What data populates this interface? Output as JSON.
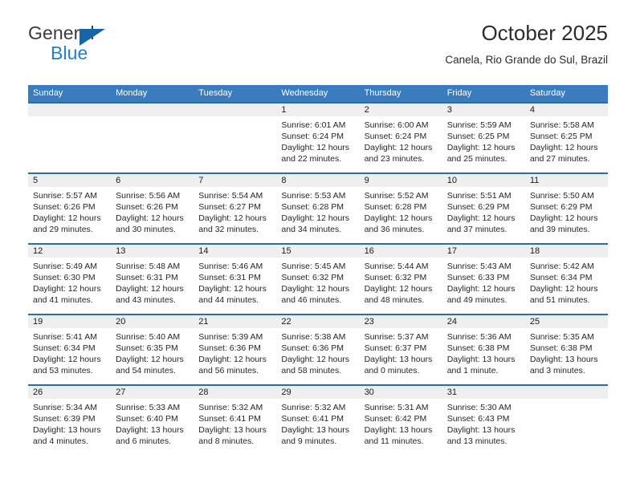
{
  "brand": {
    "name_part1": "General",
    "name_part2": "Blue",
    "triangle_color": "#1565a8",
    "blue_color": "#1f7fd0"
  },
  "header": {
    "title": "October 2025",
    "subtitle": "Canela, Rio Grande do Sul, Brazil"
  },
  "theme": {
    "header_row_bg": "#3b7cbf",
    "week_separator": "#2e6da4",
    "date_strip_bg": "#efefef"
  },
  "weekdays": [
    "Sunday",
    "Monday",
    "Tuesday",
    "Wednesday",
    "Thursday",
    "Friday",
    "Saturday"
  ],
  "weeks": [
    [
      {
        "day": "",
        "empty": true,
        "sunrise": "",
        "sunset": "",
        "daylight_line1": "",
        "daylight_line2": ""
      },
      {
        "day": "",
        "empty": true,
        "sunrise": "",
        "sunset": "",
        "daylight_line1": "",
        "daylight_line2": ""
      },
      {
        "day": "",
        "empty": true,
        "sunrise": "",
        "sunset": "",
        "daylight_line1": "",
        "daylight_line2": ""
      },
      {
        "day": "1",
        "sunrise": "Sunrise: 6:01 AM",
        "sunset": "Sunset: 6:24 PM",
        "daylight_line1": "Daylight: 12 hours",
        "daylight_line2": "and 22 minutes."
      },
      {
        "day": "2",
        "sunrise": "Sunrise: 6:00 AM",
        "sunset": "Sunset: 6:24 PM",
        "daylight_line1": "Daylight: 12 hours",
        "daylight_line2": "and 23 minutes."
      },
      {
        "day": "3",
        "sunrise": "Sunrise: 5:59 AM",
        "sunset": "Sunset: 6:25 PM",
        "daylight_line1": "Daylight: 12 hours",
        "daylight_line2": "and 25 minutes."
      },
      {
        "day": "4",
        "sunrise": "Sunrise: 5:58 AM",
        "sunset": "Sunset: 6:25 PM",
        "daylight_line1": "Daylight: 12 hours",
        "daylight_line2": "and 27 minutes."
      }
    ],
    [
      {
        "day": "5",
        "sunrise": "Sunrise: 5:57 AM",
        "sunset": "Sunset: 6:26 PM",
        "daylight_line1": "Daylight: 12 hours",
        "daylight_line2": "and 29 minutes."
      },
      {
        "day": "6",
        "sunrise": "Sunrise: 5:56 AM",
        "sunset": "Sunset: 6:26 PM",
        "daylight_line1": "Daylight: 12 hours",
        "daylight_line2": "and 30 minutes."
      },
      {
        "day": "7",
        "sunrise": "Sunrise: 5:54 AM",
        "sunset": "Sunset: 6:27 PM",
        "daylight_line1": "Daylight: 12 hours",
        "daylight_line2": "and 32 minutes."
      },
      {
        "day": "8",
        "sunrise": "Sunrise: 5:53 AM",
        "sunset": "Sunset: 6:28 PM",
        "daylight_line1": "Daylight: 12 hours",
        "daylight_line2": "and 34 minutes."
      },
      {
        "day": "9",
        "sunrise": "Sunrise: 5:52 AM",
        "sunset": "Sunset: 6:28 PM",
        "daylight_line1": "Daylight: 12 hours",
        "daylight_line2": "and 36 minutes."
      },
      {
        "day": "10",
        "sunrise": "Sunrise: 5:51 AM",
        "sunset": "Sunset: 6:29 PM",
        "daylight_line1": "Daylight: 12 hours",
        "daylight_line2": "and 37 minutes."
      },
      {
        "day": "11",
        "sunrise": "Sunrise: 5:50 AM",
        "sunset": "Sunset: 6:29 PM",
        "daylight_line1": "Daylight: 12 hours",
        "daylight_line2": "and 39 minutes."
      }
    ],
    [
      {
        "day": "12",
        "sunrise": "Sunrise: 5:49 AM",
        "sunset": "Sunset: 6:30 PM",
        "daylight_line1": "Daylight: 12 hours",
        "daylight_line2": "and 41 minutes."
      },
      {
        "day": "13",
        "sunrise": "Sunrise: 5:48 AM",
        "sunset": "Sunset: 6:31 PM",
        "daylight_line1": "Daylight: 12 hours",
        "daylight_line2": "and 43 minutes."
      },
      {
        "day": "14",
        "sunrise": "Sunrise: 5:46 AM",
        "sunset": "Sunset: 6:31 PM",
        "daylight_line1": "Daylight: 12 hours",
        "daylight_line2": "and 44 minutes."
      },
      {
        "day": "15",
        "sunrise": "Sunrise: 5:45 AM",
        "sunset": "Sunset: 6:32 PM",
        "daylight_line1": "Daylight: 12 hours",
        "daylight_line2": "and 46 minutes."
      },
      {
        "day": "16",
        "sunrise": "Sunrise: 5:44 AM",
        "sunset": "Sunset: 6:32 PM",
        "daylight_line1": "Daylight: 12 hours",
        "daylight_line2": "and 48 minutes."
      },
      {
        "day": "17",
        "sunrise": "Sunrise: 5:43 AM",
        "sunset": "Sunset: 6:33 PM",
        "daylight_line1": "Daylight: 12 hours",
        "daylight_line2": "and 49 minutes."
      },
      {
        "day": "18",
        "sunrise": "Sunrise: 5:42 AM",
        "sunset": "Sunset: 6:34 PM",
        "daylight_line1": "Daylight: 12 hours",
        "daylight_line2": "and 51 minutes."
      }
    ],
    [
      {
        "day": "19",
        "sunrise": "Sunrise: 5:41 AM",
        "sunset": "Sunset: 6:34 PM",
        "daylight_line1": "Daylight: 12 hours",
        "daylight_line2": "and 53 minutes."
      },
      {
        "day": "20",
        "sunrise": "Sunrise: 5:40 AM",
        "sunset": "Sunset: 6:35 PM",
        "daylight_line1": "Daylight: 12 hours",
        "daylight_line2": "and 54 minutes."
      },
      {
        "day": "21",
        "sunrise": "Sunrise: 5:39 AM",
        "sunset": "Sunset: 6:36 PM",
        "daylight_line1": "Daylight: 12 hours",
        "daylight_line2": "and 56 minutes."
      },
      {
        "day": "22",
        "sunrise": "Sunrise: 5:38 AM",
        "sunset": "Sunset: 6:36 PM",
        "daylight_line1": "Daylight: 12 hours",
        "daylight_line2": "and 58 minutes."
      },
      {
        "day": "23",
        "sunrise": "Sunrise: 5:37 AM",
        "sunset": "Sunset: 6:37 PM",
        "daylight_line1": "Daylight: 13 hours",
        "daylight_line2": "and 0 minutes."
      },
      {
        "day": "24",
        "sunrise": "Sunrise: 5:36 AM",
        "sunset": "Sunset: 6:38 PM",
        "daylight_line1": "Daylight: 13 hours",
        "daylight_line2": "and 1 minute."
      },
      {
        "day": "25",
        "sunrise": "Sunrise: 5:35 AM",
        "sunset": "Sunset: 6:38 PM",
        "daylight_line1": "Daylight: 13 hours",
        "daylight_line2": "and 3 minutes."
      }
    ],
    [
      {
        "day": "26",
        "sunrise": "Sunrise: 5:34 AM",
        "sunset": "Sunset: 6:39 PM",
        "daylight_line1": "Daylight: 13 hours",
        "daylight_line2": "and 4 minutes."
      },
      {
        "day": "27",
        "sunrise": "Sunrise: 5:33 AM",
        "sunset": "Sunset: 6:40 PM",
        "daylight_line1": "Daylight: 13 hours",
        "daylight_line2": "and 6 minutes."
      },
      {
        "day": "28",
        "sunrise": "Sunrise: 5:32 AM",
        "sunset": "Sunset: 6:41 PM",
        "daylight_line1": "Daylight: 13 hours",
        "daylight_line2": "and 8 minutes."
      },
      {
        "day": "29",
        "sunrise": "Sunrise: 5:32 AM",
        "sunset": "Sunset: 6:41 PM",
        "daylight_line1": "Daylight: 13 hours",
        "daylight_line2": "and 9 minutes."
      },
      {
        "day": "30",
        "sunrise": "Sunrise: 5:31 AM",
        "sunset": "Sunset: 6:42 PM",
        "daylight_line1": "Daylight: 13 hours",
        "daylight_line2": "and 11 minutes."
      },
      {
        "day": "31",
        "sunrise": "Sunrise: 5:30 AM",
        "sunset": "Sunset: 6:43 PM",
        "daylight_line1": "Daylight: 13 hours",
        "daylight_line2": "and 13 minutes."
      },
      {
        "day": "",
        "empty": true,
        "sunrise": "",
        "sunset": "",
        "daylight_line1": "",
        "daylight_line2": ""
      }
    ]
  ]
}
